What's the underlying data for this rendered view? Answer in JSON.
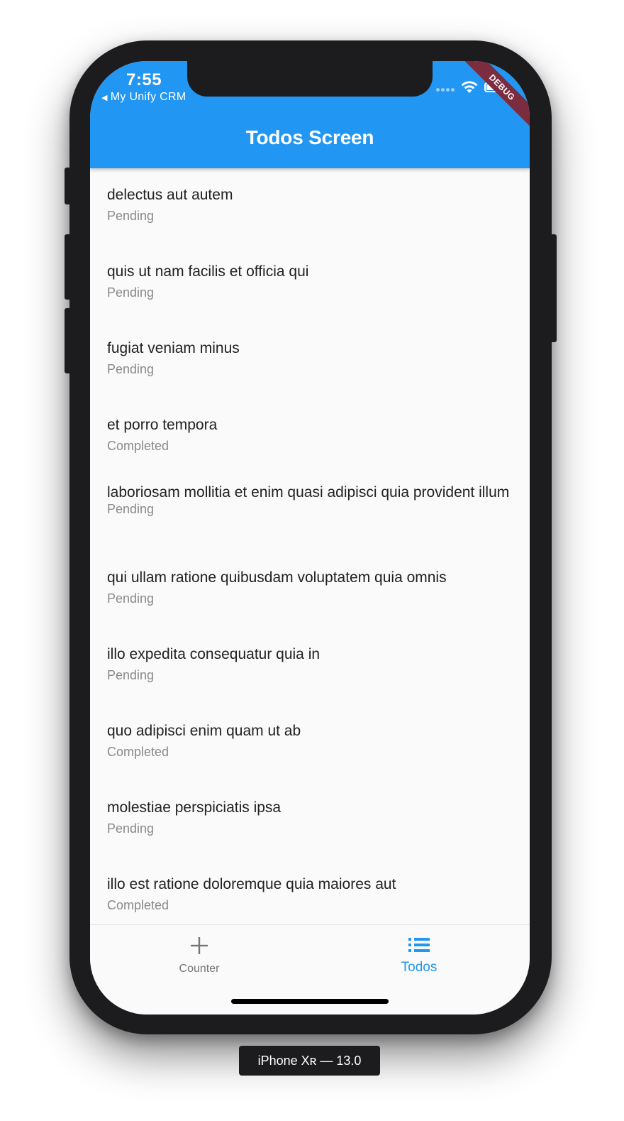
{
  "status_bar": {
    "time": "7:55",
    "back_app": "My Unify CRM"
  },
  "debug_banner": "DEBUG",
  "app_bar": {
    "title": "Todos Screen",
    "background": "#2196f3"
  },
  "todos": [
    {
      "title": "delectus aut autem",
      "status": "Pending"
    },
    {
      "title": "quis ut nam facilis et officia qui",
      "status": "Pending"
    },
    {
      "title": "fugiat veniam minus",
      "status": "Pending"
    },
    {
      "title": "et porro tempora",
      "status": "Completed"
    },
    {
      "title": "laboriosam mollitia et enim quasi adipisci quia provident illum",
      "status": "Pending"
    },
    {
      "title": "qui ullam ratione quibusdam voluptatem quia omnis",
      "status": "Pending"
    },
    {
      "title": "illo expedita consequatur quia in",
      "status": "Pending"
    },
    {
      "title": "quo adipisci enim quam ut ab",
      "status": "Completed"
    },
    {
      "title": "molestiae perspiciatis ipsa",
      "status": "Pending"
    },
    {
      "title": "illo est ratione doloremque quia maiores aut",
      "status": "Completed"
    }
  ],
  "bottom_nav": {
    "tabs": [
      {
        "label": "Counter",
        "icon": "plus-icon",
        "active": false
      },
      {
        "label": "Todos",
        "icon": "list-icon",
        "active": true
      }
    ],
    "active_color": "#2196f3",
    "inactive_color": "#757575"
  },
  "device_label": "iPhone Xʀ — 13.0"
}
